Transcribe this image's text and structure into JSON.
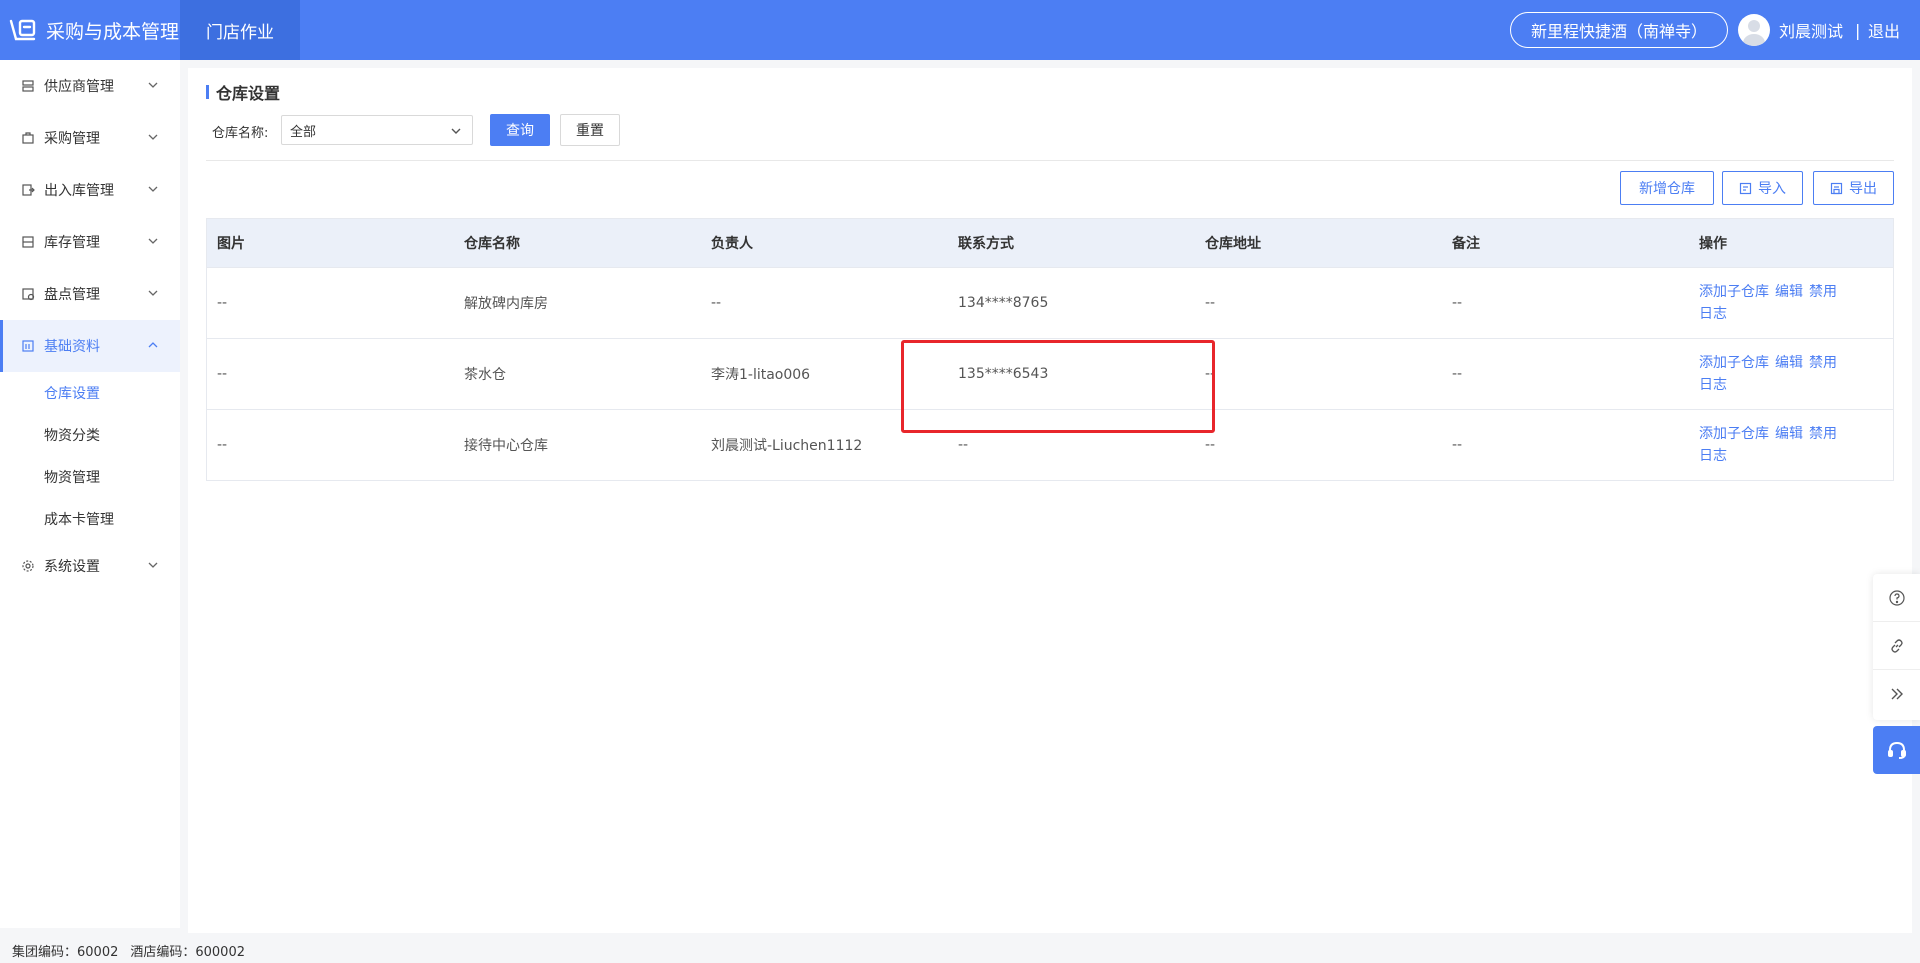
{
  "header": {
    "app_title": "采购与成本管理",
    "nav_tab": "门店作业",
    "hotel": "新里程快捷酒（南禅寺）",
    "user": "刘晨测试",
    "separator": "|",
    "logout": "退出"
  },
  "sidebar": {
    "items": [
      {
        "label": "供应商管理",
        "icon": "supplier-icon"
      },
      {
        "label": "采购管理",
        "icon": "purchase-icon"
      },
      {
        "label": "出入库管理",
        "icon": "inout-icon"
      },
      {
        "label": "库存管理",
        "icon": "stock-icon"
      },
      {
        "label": "盘点管理",
        "icon": "inventory-check-icon"
      },
      {
        "label": "基础资料",
        "icon": "basic-data-icon"
      },
      {
        "label": "系统设置",
        "icon": "gear-icon"
      }
    ],
    "sub_items": [
      "仓库设置",
      "物资分类",
      "物资管理",
      "成本卡管理"
    ]
  },
  "page": {
    "title": "仓库设置",
    "filter_label": "仓库名称:",
    "filter_value": "全部",
    "query": "查询",
    "reset": "重置",
    "add": "新增仓库",
    "import": "导入",
    "export": "导出"
  },
  "table": {
    "headers": [
      "图片",
      "仓库名称",
      "负责人",
      "联系方式",
      "仓库地址",
      "备注",
      "操作"
    ],
    "rows": [
      [
        "--",
        "解放碑内库房",
        "--",
        "134****8765",
        "--",
        "--"
      ],
      [
        "--",
        "茶水仓",
        "李涛1-litao006",
        "135****6543",
        "--",
        "--"
      ],
      [
        "--",
        "接待中心仓库",
        "刘晨测试-Liuchen1112",
        "--",
        "--",
        "--"
      ]
    ],
    "ops": [
      "添加子仓库",
      "编辑",
      "禁用",
      "日志"
    ]
  },
  "footer": {
    "group_code": "集团编码：60002",
    "hotel_code": "酒店编码：600002"
  },
  "colors": {
    "primary": "#4c7ef3",
    "highlight": "#e8262b"
  }
}
